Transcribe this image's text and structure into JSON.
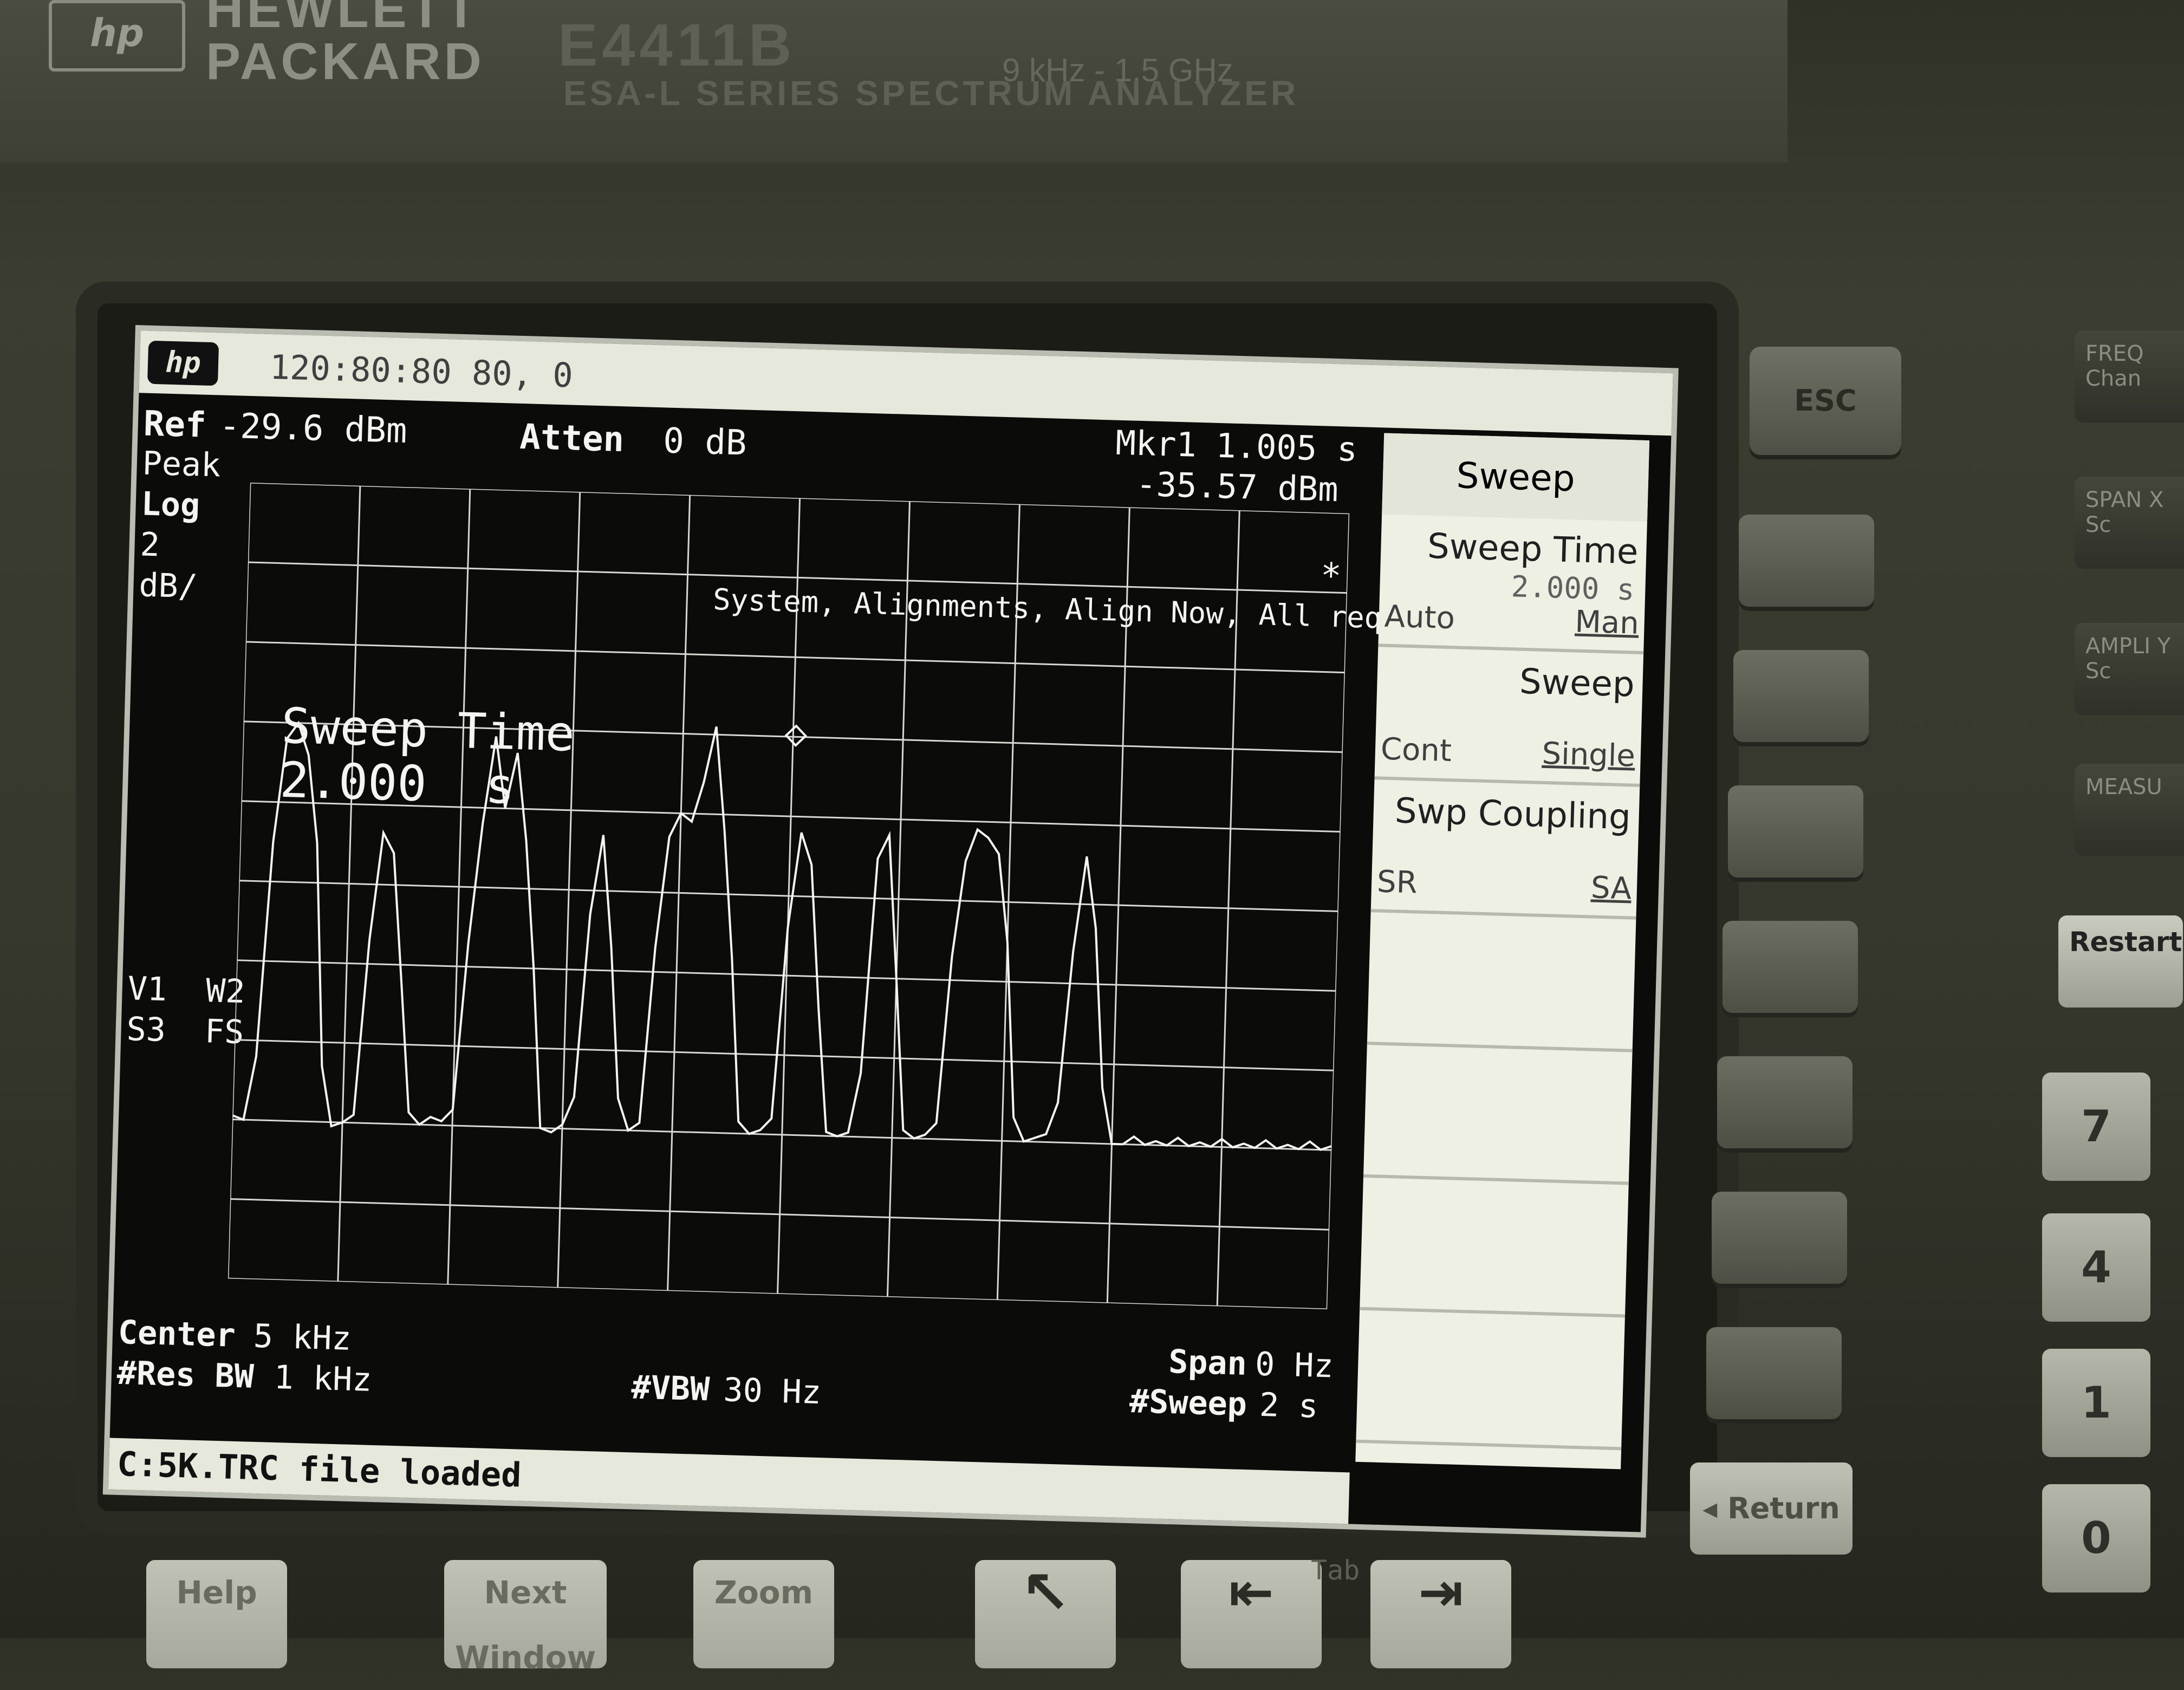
{
  "instrument": {
    "logo": "hp",
    "brand_line1": "HEWLETT",
    "brand_line2": "PACKARD",
    "model": "E4411B",
    "frequency_range": "9 kHz - 1.5 GHz",
    "series": "ESA-L SERIES SPECTRUM ANALYZER"
  },
  "display": {
    "logo": "hp",
    "title_time": "120:80:80   80,   0",
    "ref_label": "Ref",
    "ref_value": "-29.6 dBm",
    "atten_label": "Atten",
    "atten_value": "0 dB",
    "mkr_label": "Mkr1",
    "mkr_time": "1.005 s",
    "mkr_level": "-35.57 dBm",
    "detector": "Peak",
    "scale_type": "Log",
    "scale_value": "2",
    "scale_unit": "dB/",
    "trace_status_1": "V1  W2",
    "trace_status_2": "S3  FS",
    "star": "*",
    "alignment_message": "System, Alignments, Align Now, All required",
    "active_function_label": "Sweep Time",
    "active_function_value": "2.000  s",
    "center_label": "Center",
    "center_value": "5 kHz",
    "resbw_label": "#Res BW",
    "resbw_value": "1 kHz",
    "vbw_label": "#VBW",
    "vbw_value": "30 Hz",
    "span_label": "Span",
    "span_value": "0 Hz",
    "sweep_label": "#Sweep",
    "sweep_value": "2 s",
    "status_message": "C:5K.TRC file loaded"
  },
  "softkeys": {
    "menu_title": "Sweep",
    "sweep_time": {
      "label": "Sweep Time",
      "value": "2.000  s",
      "left": "Auto",
      "right": "Man"
    },
    "sweep": {
      "label": "Sweep",
      "left": "Cont",
      "right": "Single"
    },
    "coupling": {
      "label": "Swp Coupling",
      "left": "SR",
      "right": "SA"
    }
  },
  "front_panel": {
    "esc": "ESC",
    "side_labels": [
      "FREQ Chan",
      "SPAN X Sc",
      "AMPLI Y Sc",
      "MEASU"
    ],
    "restart": "Restart",
    "numbers": [
      "7",
      "4",
      "1",
      "0"
    ],
    "return_label": "Return",
    "bottom_keys": [
      "Help",
      "Next Window",
      "Zoom"
    ],
    "tab_label": "Tab"
  },
  "trace_style": {
    "color": "#f4f4f0",
    "grid_color": "#d8d8d2"
  },
  "chart_data": {
    "type": "line",
    "title": "",
    "xlabel": "",
    "ylabel": "",
    "x_unit": "s",
    "y_unit": "dBm",
    "xlim": [
      0,
      2
    ],
    "ylim": [
      -49.6,
      -29.6
    ],
    "grid": true,
    "series": [
      {
        "x": [
          0,
          0.02,
          0.04,
          0.06,
          0.08,
          0.1,
          0.12,
          0.14,
          0.16,
          0.18,
          0.2,
          0.22,
          0.24,
          0.26,
          0.28,
          0.3,
          0.32,
          0.34,
          0.36,
          0.38,
          0.4,
          0.42,
          0.44,
          0.46,
          0.48,
          0.5,
          0.52,
          0.54,
          0.56,
          0.58,
          0.6,
          0.62,
          0.64,
          0.66,
          0.68,
          0.7,
          0.72,
          0.74,
          0.76,
          0.78,
          0.8,
          0.82,
          0.84,
          0.86,
          0.88,
          0.9,
          0.92,
          0.94,
          0.96,
          0.98,
          1.0,
          1.02,
          1.04,
          1.06,
          1.08,
          1.1,
          1.12,
          1.14,
          1.16,
          1.18,
          1.2,
          1.22,
          1.24,
          1.26,
          1.28,
          1.3,
          1.32,
          1.34,
          1.36,
          1.38,
          1.4,
          1.42,
          1.44,
          1.46,
          1.48,
          1.5,
          1.52,
          1.54,
          1.56,
          1.58,
          1.6,
          1.62,
          1.64,
          1.66,
          1.68,
          1.7,
          1.72,
          1.74,
          1.76,
          1.78,
          1.8,
          1.82,
          1.84,
          1.86,
          1.88,
          1.9,
          1.92,
          1.94,
          1.96,
          1.98,
          2.0
        ],
        "y": [
          -45.5,
          -45.6,
          -44.0,
          -38.6,
          -36.0,
          -35.6,
          -36.4,
          -38.6,
          -44.2,
          -45.7,
          -45.6,
          -45.4,
          -41.0,
          -38.3,
          -38.8,
          -42.0,
          -45.3,
          -45.6,
          -45.4,
          -45.5,
          -45.2,
          -41.0,
          -38.0,
          -35.8,
          -37.6,
          -36.2,
          -38.4,
          -41.6,
          -45.6,
          -45.7,
          -45.5,
          -44.8,
          -40.2,
          -38.2,
          -41.0,
          -44.8,
          -45.6,
          -45.4,
          -41.0,
          -38.2,
          -37.6,
          -37.8,
          -36.8,
          -35.4,
          -38.0,
          -41.2,
          -45.3,
          -45.6,
          -45.5,
          -45.2,
          -40.4,
          -38.0,
          -38.8,
          -42.4,
          -45.5,
          -45.6,
          -45.5,
          -44.0,
          -38.6,
          -38.0,
          -41.6,
          -45.4,
          -45.6,
          -45.5,
          -45.2,
          -41.0,
          -38.6,
          -37.8,
          -38.0,
          -38.4,
          -40.6,
          -45.0,
          -45.6,
          -45.5,
          -45.4,
          -44.6,
          -40.8,
          -38.4,
          -40.2,
          -44.2,
          -45.6,
          -45.6,
          -45.4,
          -45.6,
          -45.5,
          -45.6,
          -45.4,
          -45.6,
          -45.5,
          -45.6,
          -45.4,
          -45.6,
          -45.5,
          -45.6,
          -45.4,
          -45.6,
          -45.5,
          -45.6,
          -45.4,
          -45.6,
          -45.5
        ]
      }
    ],
    "marker": {
      "x": 1.005,
      "y": -35.57
    }
  }
}
